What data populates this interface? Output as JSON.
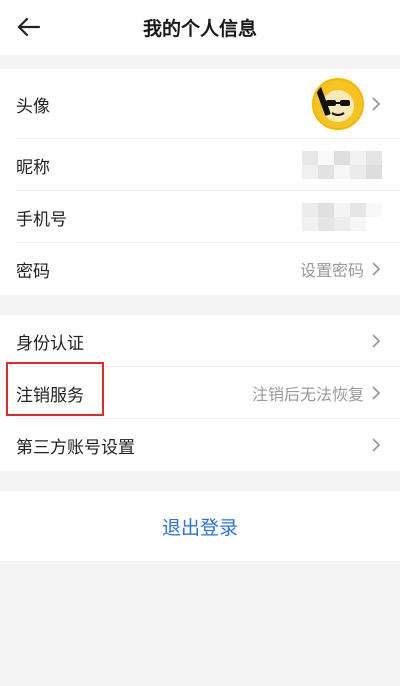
{
  "header": {
    "title": "我的个人信息"
  },
  "profile": {
    "avatar_label": "头像",
    "nickname_label": "昵称",
    "phone_label": "手机号",
    "password_label": "密码",
    "password_value": "设置密码"
  },
  "account": {
    "identity_label": "身份认证",
    "cancel_label": "注销服务",
    "cancel_value": "注销后无法恢复",
    "thirdparty_label": "第三方账号设置"
  },
  "logout": {
    "label": "退出登录"
  },
  "colors": {
    "accent": "#2f72d8",
    "highlight": "#e02b2b",
    "avatar_bg": "#f7c41f"
  }
}
